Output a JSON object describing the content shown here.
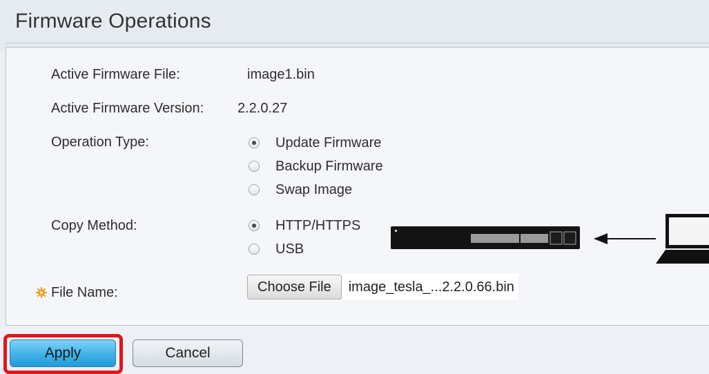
{
  "page": {
    "title": "Firmware Operations"
  },
  "form": {
    "active_file": {
      "label": "Active Firmware File:",
      "value": "image1.bin"
    },
    "active_version": {
      "label": "Active Firmware Version:",
      "value": "2.2.0.27"
    },
    "operation_type": {
      "label": "Operation Type:",
      "options": [
        {
          "label": "Update Firmware",
          "checked": true
        },
        {
          "label": "Backup Firmware",
          "checked": false
        },
        {
          "label": "Swap Image",
          "checked": false
        }
      ]
    },
    "copy_method": {
      "label": "Copy Method:",
      "options": [
        {
          "label": "HTTP/HTTPS",
          "checked": true
        },
        {
          "label": "USB",
          "checked": false
        }
      ]
    },
    "file_name": {
      "label": "File Name:",
      "required_icon": "gear-icon",
      "button_label": "Choose File",
      "selected_file": "image_tesla_...2.2.0.66.bin"
    }
  },
  "actions": {
    "apply_label": "Apply",
    "cancel_label": "Cancel"
  },
  "colors": {
    "apply_highlight": "#e0161b",
    "required_icon": "#f0a020",
    "apply_button": "#3fb1e8"
  },
  "icons": {
    "switch": "network-switch-icon",
    "arrow": "arrow-left-icon",
    "computer": "laptop-icon"
  }
}
